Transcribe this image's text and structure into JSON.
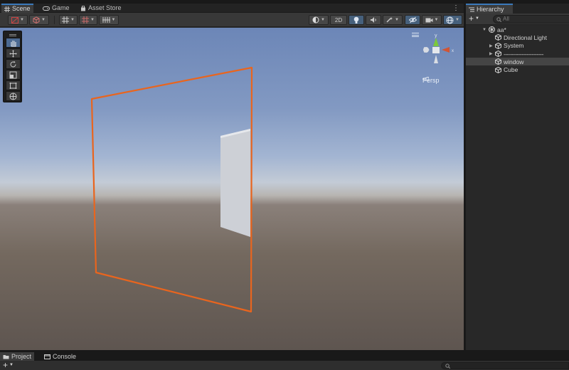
{
  "scene_tabs": {
    "scene": "Scene",
    "game": "Game",
    "asset_store": "Asset Store"
  },
  "scene_toolbar": {
    "mode_2d": "2D"
  },
  "viewport": {
    "projection_label": "Persp",
    "gizmo_axes": {
      "y": "y",
      "x": "x"
    }
  },
  "tools": [
    "hand-tool",
    "move-tool",
    "rotate-tool",
    "scale-tool",
    "rect-tool",
    "transform-tool"
  ],
  "hierarchy": {
    "tab": "Hierarchy",
    "search_placeholder": "All",
    "scene_name": "aa*",
    "items": [
      {
        "label": "Directional Light",
        "has_children": false,
        "selected": false
      },
      {
        "label": "System",
        "has_children": true,
        "selected": false
      },
      {
        "label": "------------------------",
        "has_children": true,
        "selected": false
      },
      {
        "label": "window",
        "has_children": false,
        "selected": true
      },
      {
        "label": "Cube",
        "has_children": false,
        "selected": false
      }
    ]
  },
  "bottom_tabs": {
    "project": "Project",
    "console": "Console"
  },
  "colors": {
    "selection_outline": "#e9651e",
    "tab_accent": "#3a79bb",
    "gizmo_y": "#7cc83c",
    "gizmo_x": "#d05535"
  }
}
